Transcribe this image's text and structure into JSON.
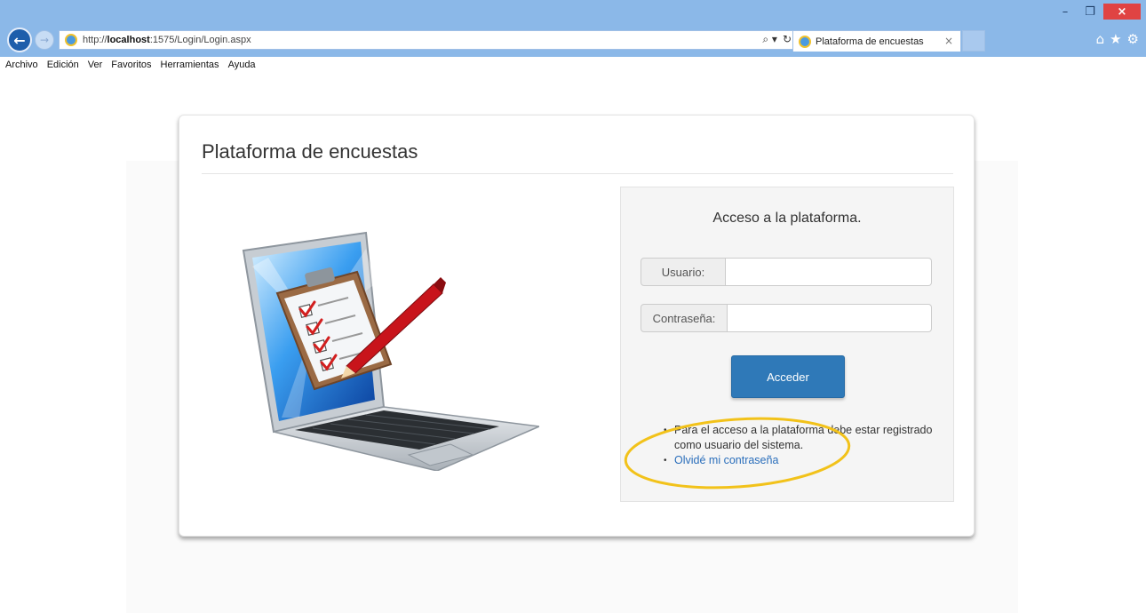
{
  "browser": {
    "url_prefix": "http://",
    "url_host": "localhost",
    "url_rest": ":1575/Login/Login.aspx",
    "search_icon": "search-icon",
    "refresh_icon": "refresh-icon",
    "tab_title": "Plataforma de encuestas",
    "tab_close": "×",
    "window_min": "–",
    "window_restore": "❐",
    "window_close": "×",
    "icons": [
      "home-icon",
      "favorites-icon",
      "settings-icon"
    ]
  },
  "menu": {
    "items": [
      "Archivo",
      "Edición",
      "Ver",
      "Favoritos",
      "Herramientas",
      "Ayuda"
    ]
  },
  "page": {
    "title": "Plataforma de encuestas",
    "login": {
      "heading": "Acceso a la plataforma.",
      "username_label": "Usuario:",
      "password_label": "Contraseña:",
      "submit_label": "Acceder",
      "info_text": "Para el acceso a la plataforma debe estar registrado como usuario del sistema.",
      "forgot_link": "Olvidé mi contraseña"
    }
  },
  "colors": {
    "chrome": "#8bb8e8",
    "button_primary": "#2f79b8",
    "link": "#2a6ebb",
    "highlight": "#f2c21a"
  }
}
